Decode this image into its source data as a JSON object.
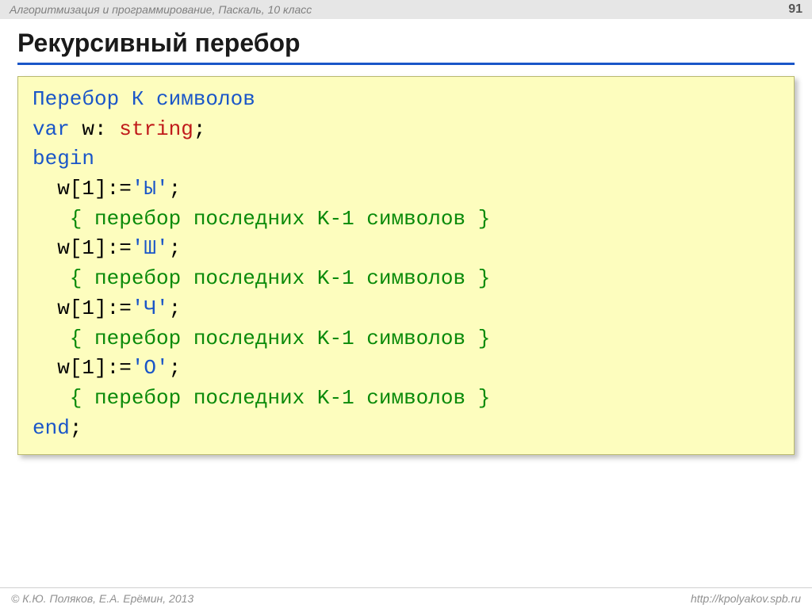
{
  "header": {
    "course_title": "Алгоритмизация и программирование, Паскаль, 10 класс",
    "page_number": "91"
  },
  "title": "Рекурсивный перебор",
  "code": {
    "heading": "Перебор К символов",
    "kw_var": "var",
    "var_name": " w: ",
    "type": "string",
    "semi": ";",
    "kw_begin": "begin",
    "lines": [
      {
        "assign_left": "  w[1]:=",
        "literal": "'Ы'",
        "after": ";"
      },
      {
        "assign_left": "  w[1]:=",
        "literal": "'Ш'",
        "after": ";"
      },
      {
        "assign_left": "  w[1]:=",
        "literal": "'Ч'",
        "after": ";"
      },
      {
        "assign_left": "  w[1]:=",
        "literal": "'О'",
        "after": ";"
      }
    ],
    "comment": "   { перебор последних K-1 символов }",
    "kw_end": "end",
    "end_semi": ";"
  },
  "footer": {
    "copyright": "© К.Ю. Поляков, Е.А. Ерёмин, 2013",
    "url": "http://kpolyakov.spb.ru"
  }
}
